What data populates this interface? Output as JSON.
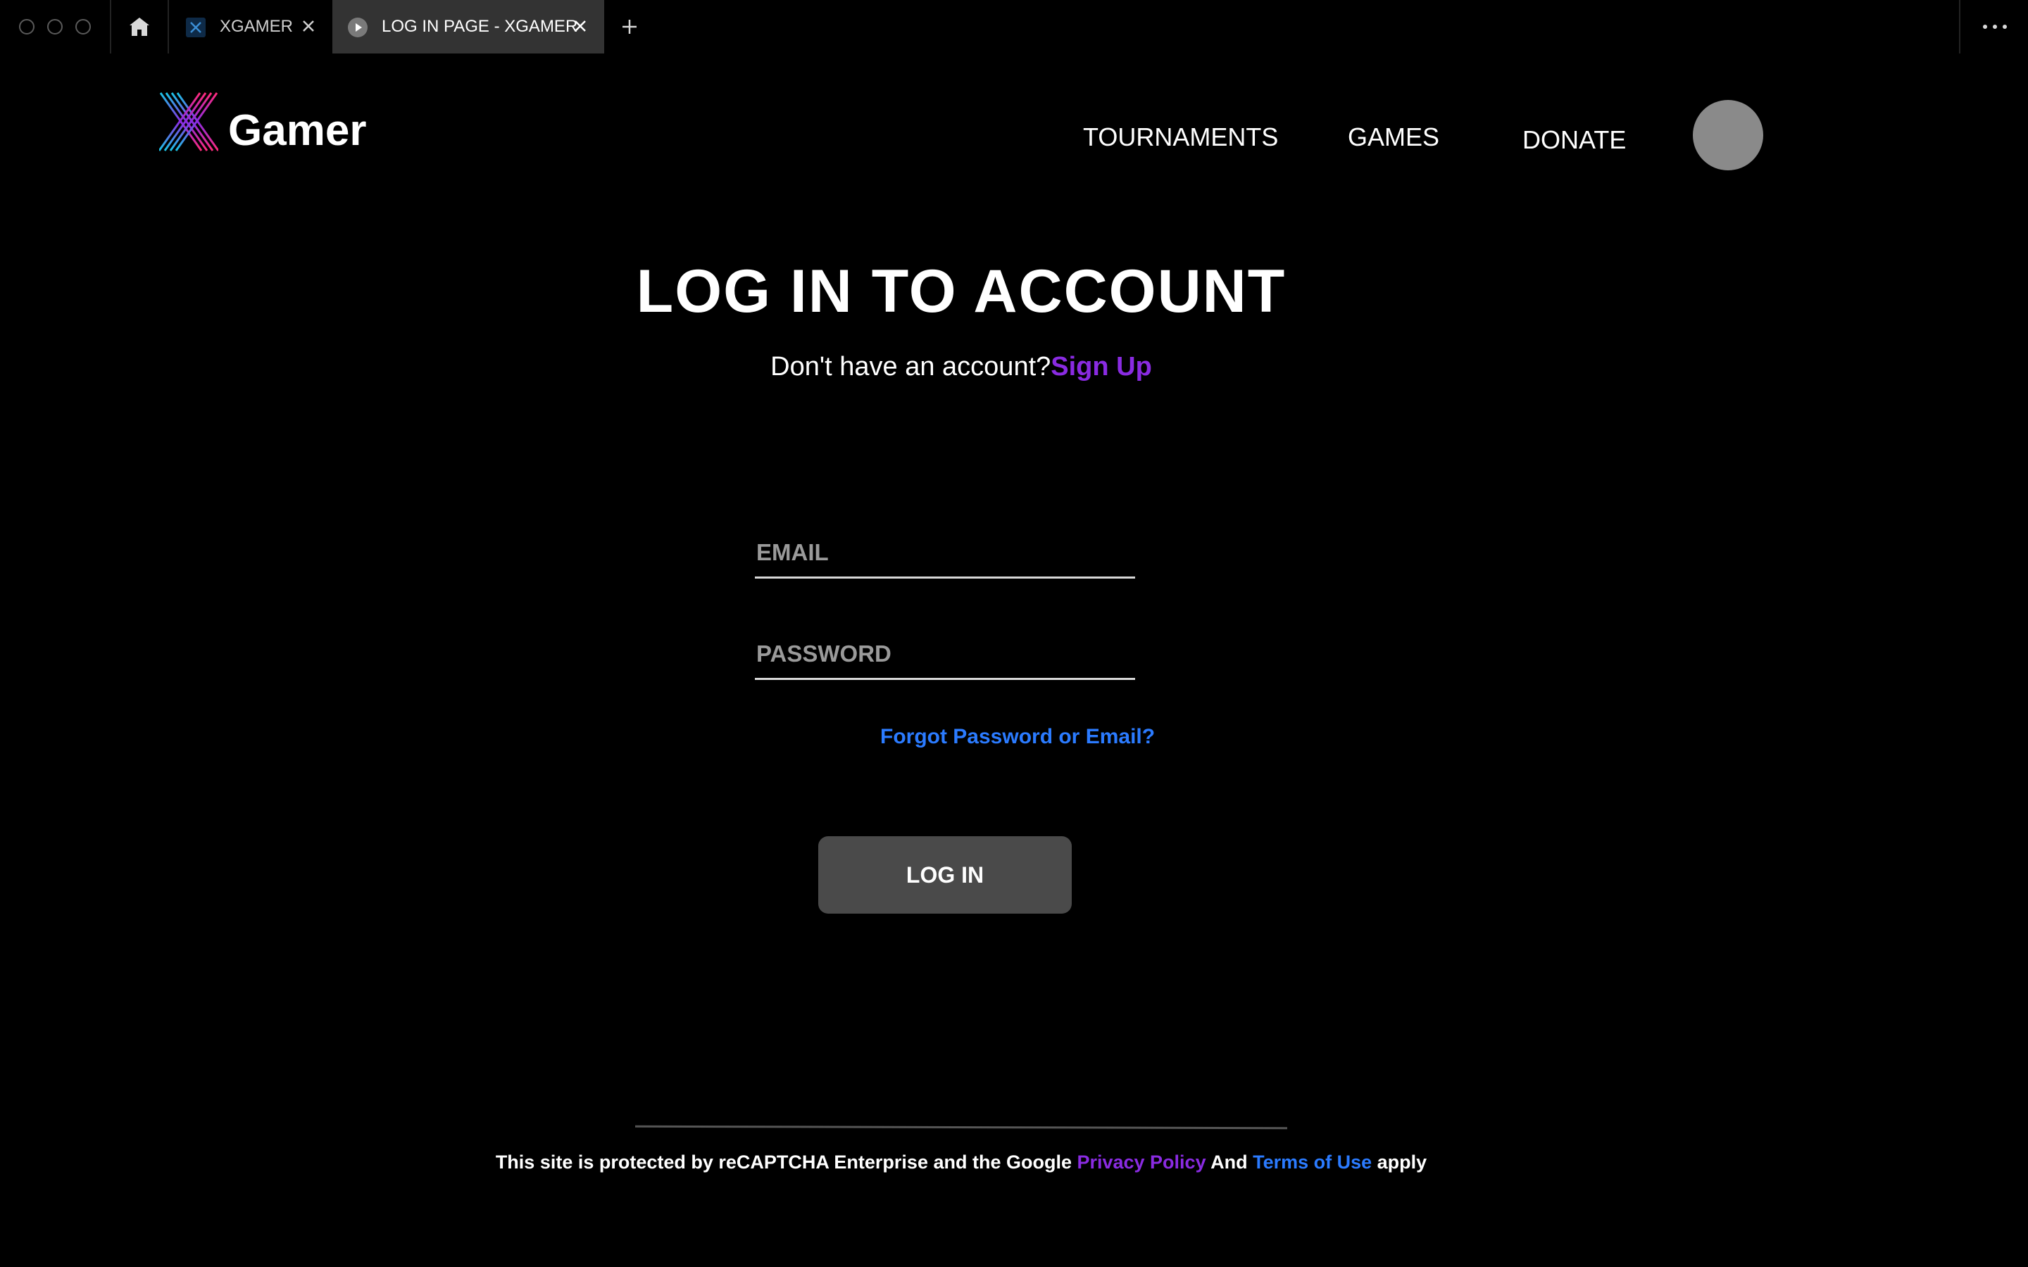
{
  "browser": {
    "tabs": [
      {
        "title": "XGAMER",
        "active": false
      },
      {
        "title": "LOG IN PAGE - XGAMER",
        "active": true
      }
    ],
    "icons": {
      "home": "home-icon",
      "new_tab": "plus-icon",
      "close": "close-icon",
      "more": "more-horizontal-icon"
    }
  },
  "header": {
    "logo_text": "Gamer",
    "nav": [
      "TOURNAMENTS",
      "GAMES",
      "DONATE"
    ]
  },
  "login": {
    "title": "LOG IN TO ACCOUNT",
    "no_account_text": "Don't have an account?",
    "signup_label": "Sign Up",
    "email_placeholder": "EMAIL",
    "email_value": "",
    "password_placeholder": "PASSWORD",
    "password_value": "",
    "forgot_label": "Forgot Password or Email?",
    "login_button": "LOG IN"
  },
  "footer": {
    "prefix": "This site is protected by reCAPTCHA Enterprise and the Google ",
    "privacy": "Privacy Policy",
    "and": " And ",
    "terms": "Terms of Use",
    "suffix": " apply"
  },
  "colors": {
    "background": "#000000",
    "accent_purple": "#8a2be2",
    "accent_blue": "#2b7bff",
    "button": "#4a4a4a",
    "avatar": "#8a8a8a"
  }
}
